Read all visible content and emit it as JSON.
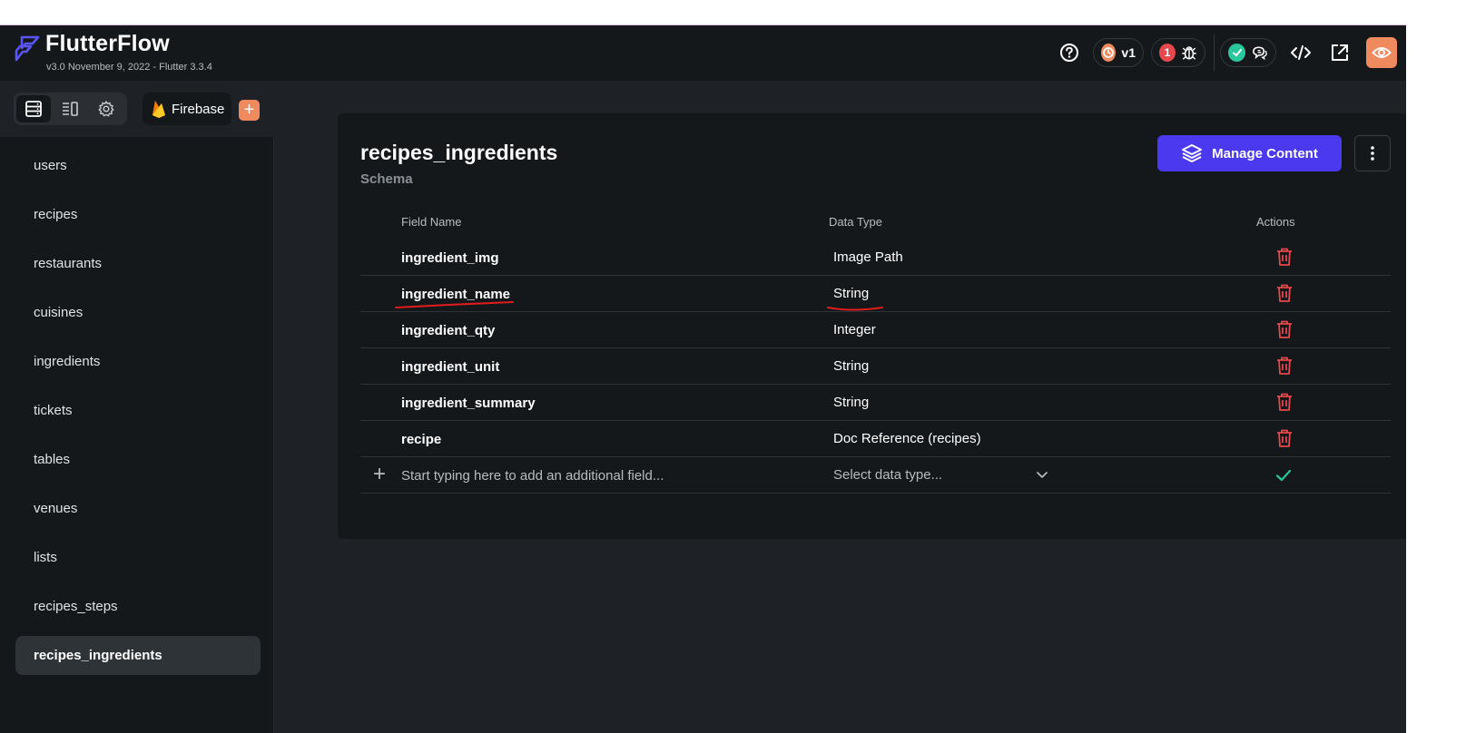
{
  "header": {
    "brand": "FlutterFlow",
    "version": "v3.0 November 9, 2022 - Flutter 3.3.4",
    "version_badge": "v1",
    "issues_count": "1",
    "accent": "#ef8a5f"
  },
  "sidebar": {
    "source_label": "Firebase",
    "add_label": "+",
    "collections": [
      {
        "label": "users"
      },
      {
        "label": "recipes"
      },
      {
        "label": "restaurants"
      },
      {
        "label": "cuisines"
      },
      {
        "label": "ingredients"
      },
      {
        "label": "tickets"
      },
      {
        "label": "tables"
      },
      {
        "label": "venues"
      },
      {
        "label": "lists"
      },
      {
        "label": "recipes_steps"
      },
      {
        "label": "recipes_ingredients"
      }
    ],
    "active_index": 10
  },
  "main": {
    "title": "recipes_ingredients",
    "subtitle": "Schema",
    "manage_label": "Manage Content",
    "manage_color": "#4b39ef",
    "columns": {
      "field": "Field Name",
      "type": "Data Type",
      "actions": "Actions"
    },
    "fields": [
      {
        "name": "ingredient_img",
        "type": "Image Path"
      },
      {
        "name": "ingredient_name",
        "type": "String"
      },
      {
        "name": "ingredient_qty",
        "type": "Integer"
      },
      {
        "name": "ingredient_unit",
        "type": "String"
      },
      {
        "name": "ingredient_summary",
        "type": "String"
      },
      {
        "name": "recipe",
        "type": "Doc Reference (recipes)"
      }
    ],
    "new_field": {
      "placeholder": "Start typing here to add an additional field...",
      "type_placeholder": "Select data type..."
    },
    "delete_color": "#e5484d",
    "confirm_color": "#29c79b"
  }
}
